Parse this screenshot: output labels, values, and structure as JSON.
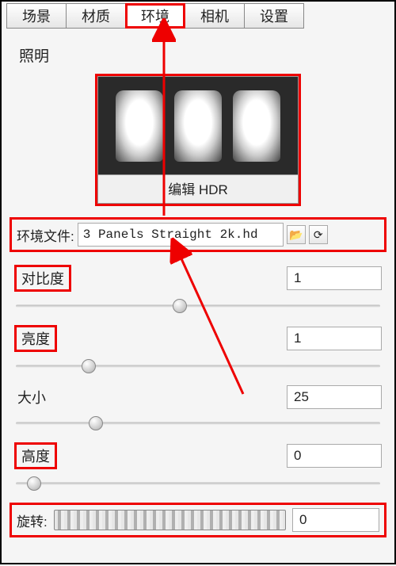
{
  "tabs": {
    "scene": "场景",
    "material": "材质",
    "environment": "环境",
    "camera": "相机",
    "settings": "设置"
  },
  "section": {
    "lighting": "照明"
  },
  "hdr": {
    "edit_label": "编辑 HDR"
  },
  "env_file": {
    "label": "环境文件:",
    "value": "3 Panels Straight 2k.hd"
  },
  "params": {
    "contrast": {
      "label": "对比度",
      "value": "1"
    },
    "brightness": {
      "label": "亮度",
      "value": "1"
    },
    "size": {
      "label": "大小",
      "value": "25"
    },
    "height": {
      "label": "高度",
      "value": "0"
    },
    "rotation": {
      "label": "旋转:",
      "value": "0"
    }
  },
  "icons": {
    "folder": "📂",
    "refresh": "⟳"
  }
}
